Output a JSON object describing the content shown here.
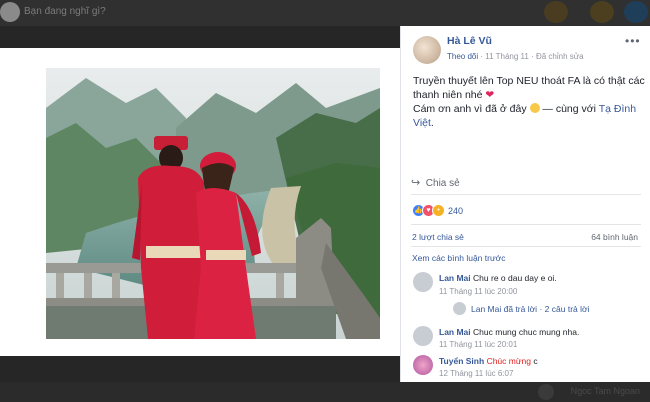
{
  "topbar": {
    "status_placeholder": "Bạn đang nghĩ gì?"
  },
  "post": {
    "author": "Hà Lê Vũ",
    "follow_label": "Theo dõi",
    "time": "11 Tháng 11",
    "edited": "Đã chỉnh sửa",
    "text_line1": "Truyền thuyết lên Top NEU thoát FA là có thật các thanh niên nhé",
    "text_line2": "Cám ơn anh vì đã ở đây",
    "with_prefix": "— cùng với",
    "tagged_name": "Tạ Đình Việt",
    "share_label": "Chia sẻ",
    "reaction_count": "240",
    "shares_count": "2 lượt chia sẻ",
    "comments_count": "64 bình luận",
    "view_previous": "Xem các bình luận trước",
    "icons": [
      "more-icon",
      "share-icon",
      "like-icon",
      "love-icon",
      "wow-icon",
      "heart-emoji",
      "smile-emoji"
    ]
  },
  "comments": [
    {
      "name": "Lan Mai",
      "text": "Chu re o dau day e oi.",
      "time": "11 Tháng 11 lúc 20:00",
      "reply_name": "Lan Mai",
      "reply_action": "đã trả lời",
      "reply_sep": "·",
      "reply_count": "2 câu trả lời"
    },
    {
      "name": "Lan Mai",
      "text": "Chuc mung chuc mung nha.",
      "time": "11 Tháng 11 lúc 20:01"
    },
    {
      "name": "Tuyển Sinh",
      "text_red": "Chúc mừng",
      "text": "c",
      "time": "12 Tháng 11 lúc 6:07"
    }
  ],
  "bottombar": {
    "ghost_text": "Ngoc Tam Ngoan"
  },
  "colors": {
    "link": "#365899",
    "background": "#262626",
    "heart": "#e0245e"
  }
}
